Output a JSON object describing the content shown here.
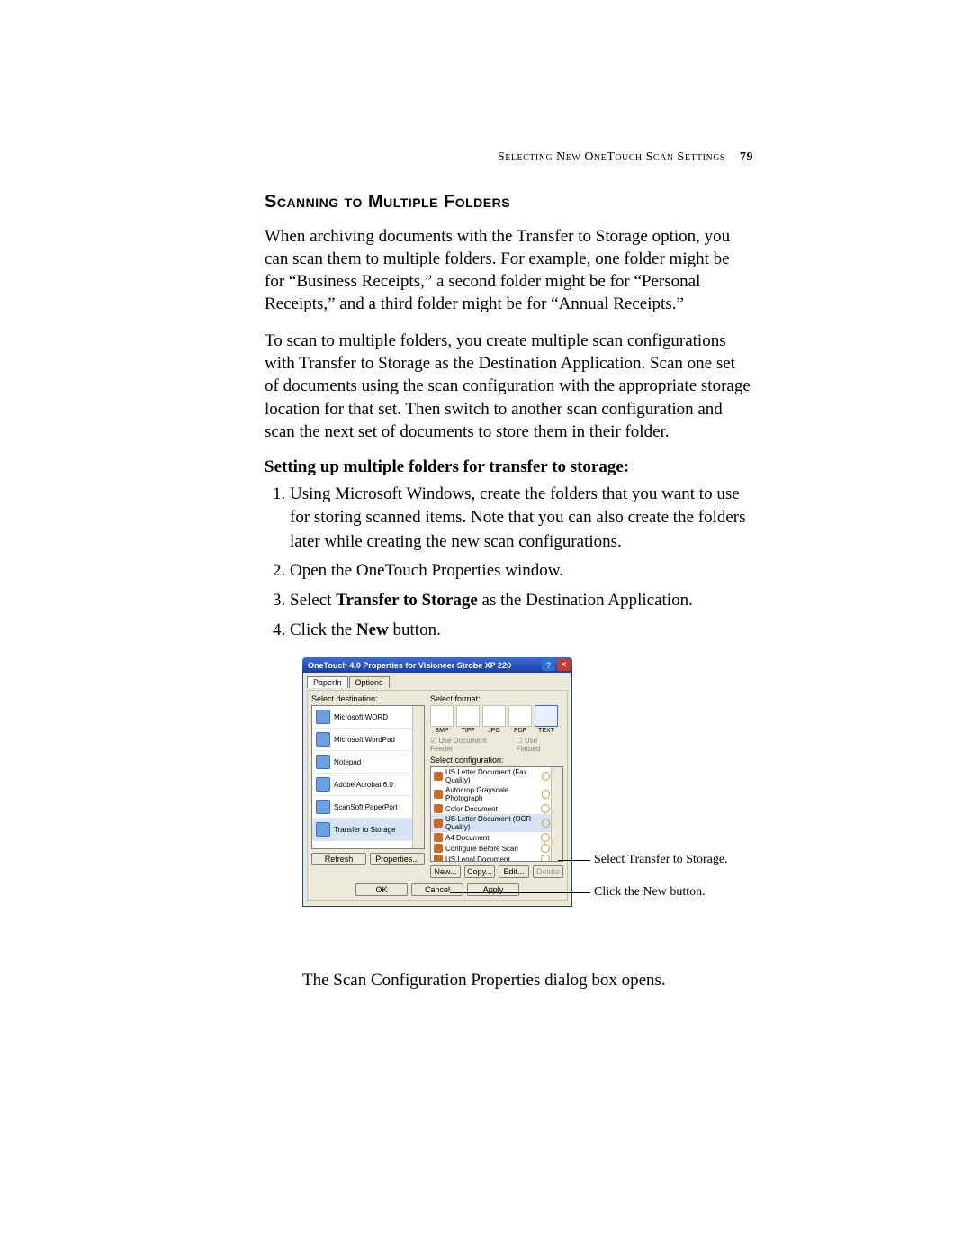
{
  "header": {
    "running": "Selecting New OneTouch Scan Settings",
    "page": "79"
  },
  "section_title": "Scanning to Multiple Folders",
  "para1": "When archiving documents with the Transfer to Storage option, you can scan them to multiple folders. For example, one folder might be for “Business Receipts,” a second folder might be for “Personal Receipts,” and a third folder might be for “Annual Receipts.”",
  "para2": "To scan to multiple folders, you create multiple scan configurations with Transfer to Storage as the Destination Application. Scan one set of documents using the scan configuration with the appropriate storage location for that set. Then switch to another scan configuration and scan the next set of documents to store them in their folder.",
  "subhead": "Setting up multiple folders for transfer to storage:",
  "steps": [
    "Using Microsoft Windows, create the folders that you want to use for storing scanned items. Note that you can also create the folders later while creating the new scan configurations.",
    "Open the OneTouch Properties window."
  ],
  "step3_pre": "Select ",
  "step3_b": "Transfer to Storage",
  "step3_post": " as the Destination Application.",
  "step4_pre": "Click the ",
  "step4_b": "New",
  "step4_post": " button.",
  "after": "The Scan Configuration Properties dialog box opens.",
  "callouts": {
    "a": "Select Transfer to Storage.",
    "b": "Click the New button."
  },
  "dialog": {
    "title": "OneTouch 4.0 Properties for Visioneer Strobe XP 220",
    "tabs": [
      "PaperIn",
      "Options"
    ],
    "labels": {
      "dest": "Select destination:",
      "format": "Select format:",
      "config": "Select configuration:",
      "chk_feeder": "Use Document Feeder",
      "chk_flatbed": "Use Flatbed"
    },
    "formats": [
      "BMP",
      "TIFF",
      "JPG",
      "PDF",
      "TEXT"
    ],
    "destinations": [
      "Microsoft WORD",
      "Microsoft WordPad",
      "Notepad",
      "Adobe Acrobat 6.0",
      "ScanSoft PaperPort",
      "Transfer to Storage"
    ],
    "configs": [
      "US Letter Document (Fax Quality)",
      "Autocrop Grayscale Photograph",
      "Color Document",
      "US Letter Document (OCR Quality)",
      "A4 Document",
      "Configure Before Scan",
      "US Legal Document"
    ],
    "btns": {
      "refresh": "Refresh",
      "properties": "Properties...",
      "new": "New...",
      "copy": "Copy...",
      "edit": "Edit...",
      "delete": "Delete",
      "ok": "OK",
      "cancel": "Cancel",
      "apply": "Apply"
    }
  }
}
